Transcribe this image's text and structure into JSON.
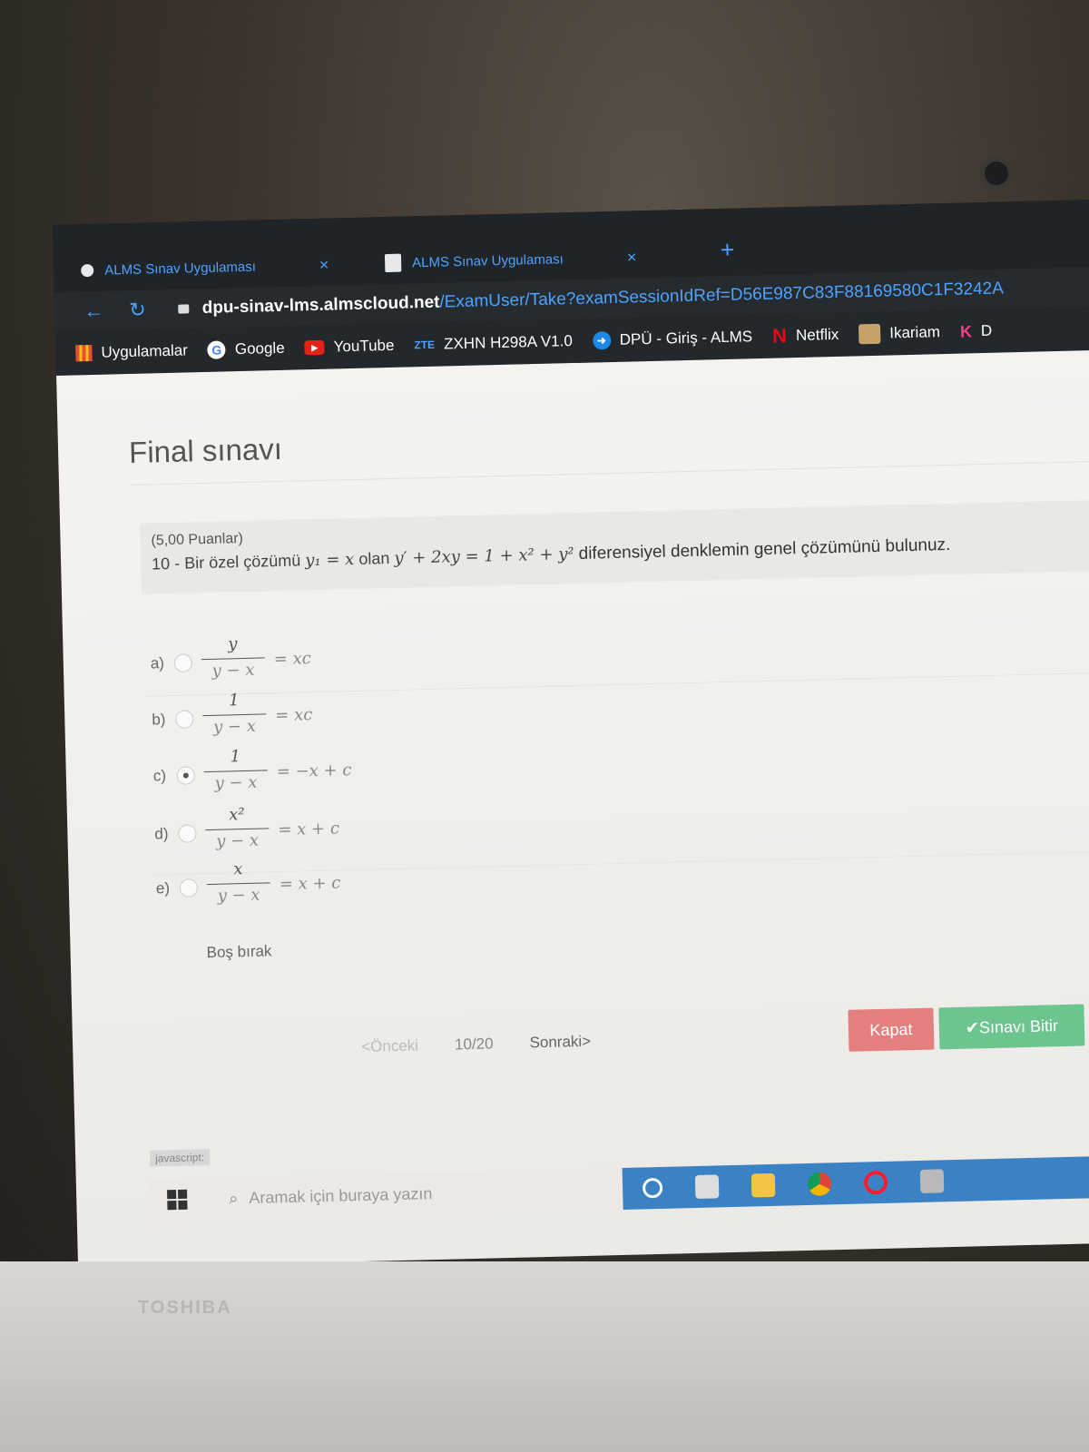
{
  "tabs": [
    {
      "title": "ALMS Sınav Uygulaması",
      "close": "×"
    },
    {
      "title": "ALMS Sınav Uygulaması",
      "close": "×"
    }
  ],
  "new_tab": "+",
  "address": {
    "host": "dpu-sinav-lms.almscloud.net",
    "path": "/ExamUser/Take?examSessionIdRef=D56E987C83F88169580C1F3242A"
  },
  "bookmarks": [
    {
      "label": "Uygulamalar",
      "icon": "apps-icon"
    },
    {
      "label": "Google",
      "icon": "google-icon"
    },
    {
      "label": "YouTube",
      "icon": "youtube-icon"
    },
    {
      "label": "ZXHN H298A V1.0",
      "icon": "zte-icon",
      "icon_text": "ZTE"
    },
    {
      "label": "DPÜ - Giriş - ALMS",
      "icon": "dpu-icon"
    },
    {
      "label": "Netflix",
      "icon": "netflix-icon"
    },
    {
      "label": "Ikariam",
      "icon": "ikariam-icon"
    },
    {
      "label": "D",
      "icon": "k-icon"
    }
  ],
  "page": {
    "title": "Final sınavı",
    "points": "(5,00 Puanlar)",
    "question_number": "10 -",
    "question_prefix": "Bir özel çözümü",
    "particular_solution": "y₁ = x",
    "question_middle": "olan",
    "equation": "y′ + 2xy = 1 + x² + y²",
    "question_suffix": "diferensiyel denklemin genel çözümünü bulunuz."
  },
  "options": [
    {
      "letter": "a)",
      "num": "y",
      "den": "y − x",
      "rhs": "= xc",
      "selected": false
    },
    {
      "letter": "b)",
      "num": "1",
      "den": "y − x",
      "rhs": "= xc",
      "selected": false
    },
    {
      "letter": "c)",
      "num": "1",
      "den": "y − x",
      "rhs": "= −x + c",
      "selected": true
    },
    {
      "letter": "d)",
      "num": "x²",
      "den": "y − x",
      "rhs": "= x + c",
      "selected": false
    },
    {
      "letter": "e)",
      "num": "x",
      "den": "y − x",
      "rhs": "= x + c",
      "selected": false
    }
  ],
  "blank_option": "Boş bırak",
  "pager": {
    "prev": "<Önceki",
    "position": "10/20",
    "next": "Sonraki>"
  },
  "buttons": {
    "close": "Kapat",
    "finish": "✔Sınavı Bitir"
  },
  "status_text": "javascript:",
  "taskbar": {
    "search_placeholder": "Aramak için buraya yazın"
  },
  "device_brand": "TOSHIBA"
}
